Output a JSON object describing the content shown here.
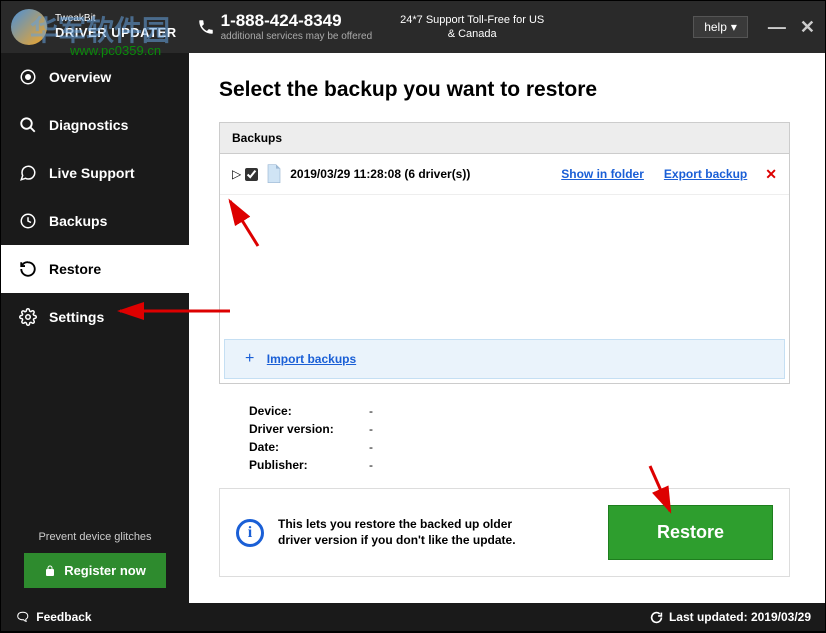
{
  "titlebar": {
    "brand_small": "TweakBit",
    "brand_main": "DRIVER UPDATER",
    "phone": "1-888-424-8349",
    "phone_sub": "additional services may be offered",
    "support": "24*7 Support Toll-Free for US & Canada",
    "help": "help"
  },
  "watermark": {
    "text": "华军软件园",
    "url": "www.pc0359.cn"
  },
  "sidebar": {
    "items": [
      {
        "label": "Overview"
      },
      {
        "label": "Diagnostics"
      },
      {
        "label": "Live Support"
      },
      {
        "label": "Backups"
      },
      {
        "label": "Restore"
      },
      {
        "label": "Settings"
      }
    ],
    "prevent": "Prevent device glitches",
    "register": "Register now"
  },
  "main": {
    "title": "Select the backup you want to restore",
    "backups_header": "Backups",
    "backup_item": "2019/03/29 11:28:08 (6 driver(s))",
    "show_in_folder": "Show in folder",
    "export_backup": "Export backup",
    "import": "Import backups",
    "details": {
      "device_label": "Device:",
      "device_val": "-",
      "version_label": "Driver version:",
      "version_val": "-",
      "date_label": "Date:",
      "date_val": "-",
      "publisher_label": "Publisher:",
      "publisher_val": "-"
    },
    "info": "This lets you restore the backed up older driver version if you don't like the update.",
    "restore_btn": "Restore"
  },
  "statusbar": {
    "feedback": "Feedback",
    "updated": "Last updated: 2019/03/29"
  }
}
